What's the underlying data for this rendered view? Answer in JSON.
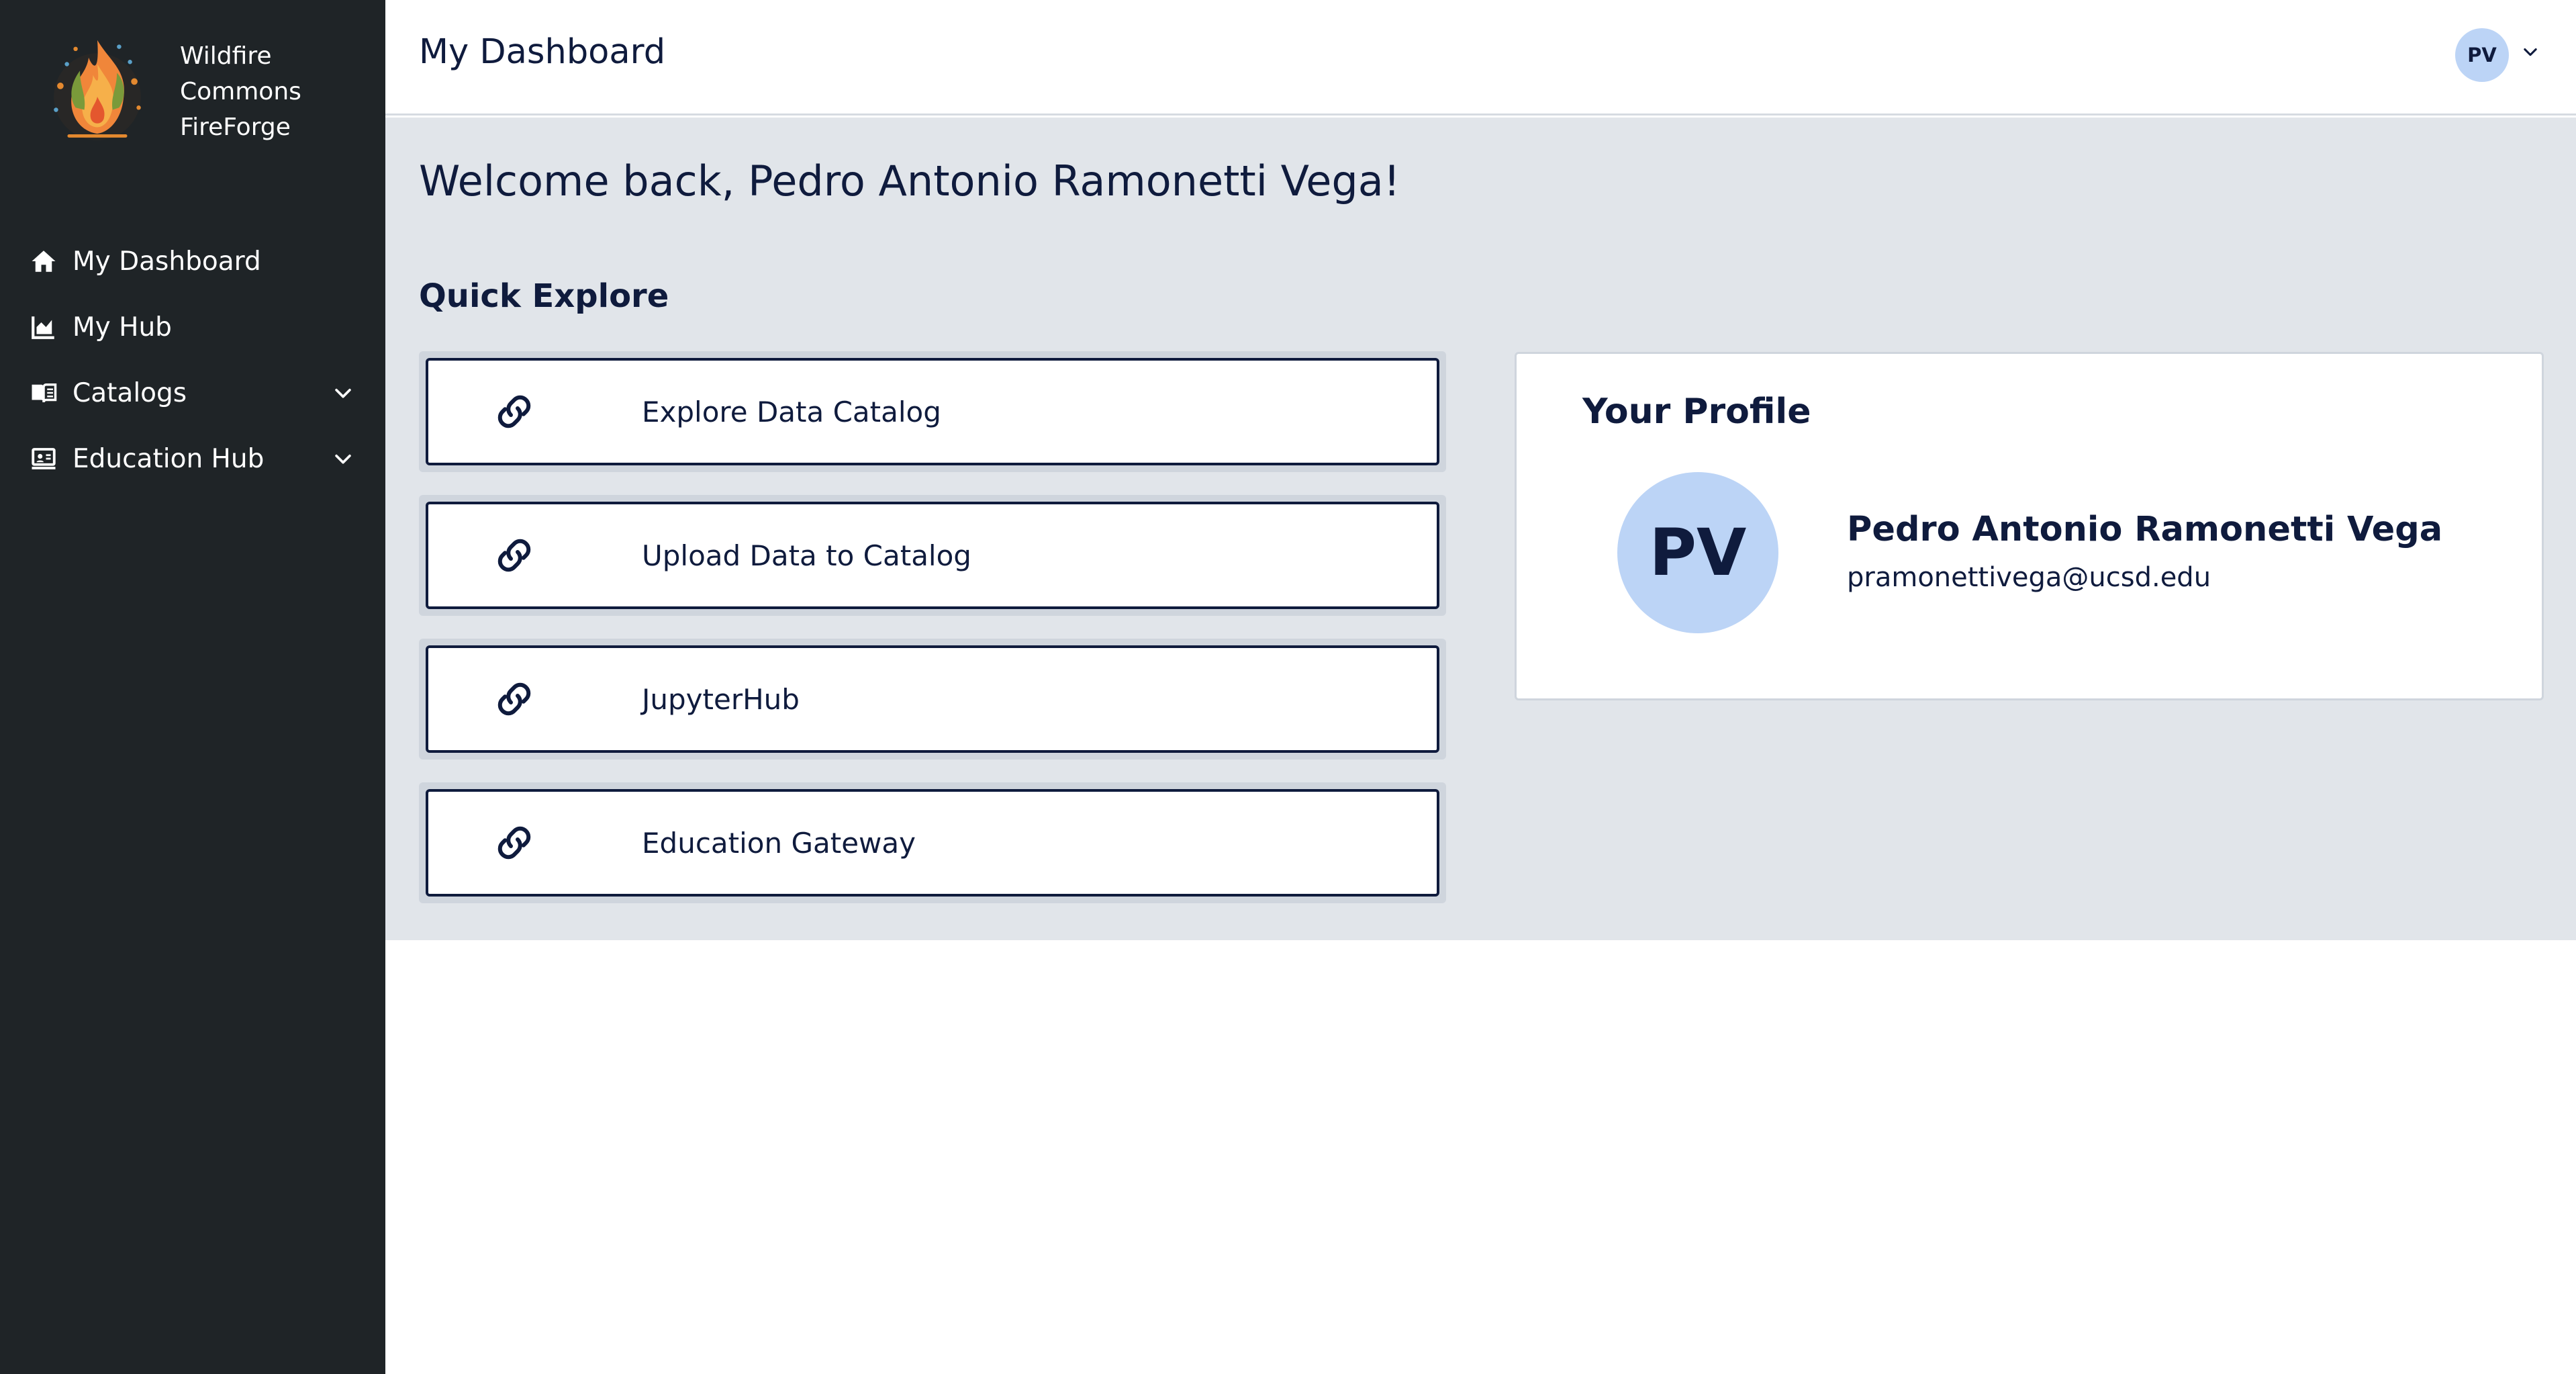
{
  "brand": {
    "line1": "Wildfire",
    "line2": "Commons",
    "line3": "FireForge"
  },
  "sidebar": {
    "items": [
      {
        "label": "My Dashboard",
        "icon": "home-icon"
      },
      {
        "label": "My Hub",
        "icon": "chart-area-icon"
      },
      {
        "label": "Catalogs",
        "icon": "book-icon",
        "expandable": true
      },
      {
        "label": "Education Hub",
        "icon": "presentation-icon",
        "expandable": true
      }
    ]
  },
  "header": {
    "title": "My Dashboard",
    "user_initials": "PV"
  },
  "main": {
    "welcome": "Welcome back, Pedro Antonio Ramonetti Vega!",
    "quick_explore_title": "Quick Explore",
    "quick_links": [
      {
        "label": "Explore Data Catalog",
        "icon": "link-icon"
      },
      {
        "label": "Upload Data to Catalog",
        "icon": "link-icon"
      },
      {
        "label": "JupyterHub",
        "icon": "link-icon"
      },
      {
        "label": "Education Gateway",
        "icon": "link-icon"
      }
    ]
  },
  "profile": {
    "title": "Your Profile",
    "initials": "PV",
    "name": "Pedro Antonio Ramonetti Vega",
    "email": "pramonettivega@ucsd.edu"
  },
  "colors": {
    "sidebar_bg": "#1f2427",
    "panel_bg": "#e1e5ea",
    "navy_text": "#0f1b3d",
    "avatar_bg": "#bcd4f6"
  }
}
